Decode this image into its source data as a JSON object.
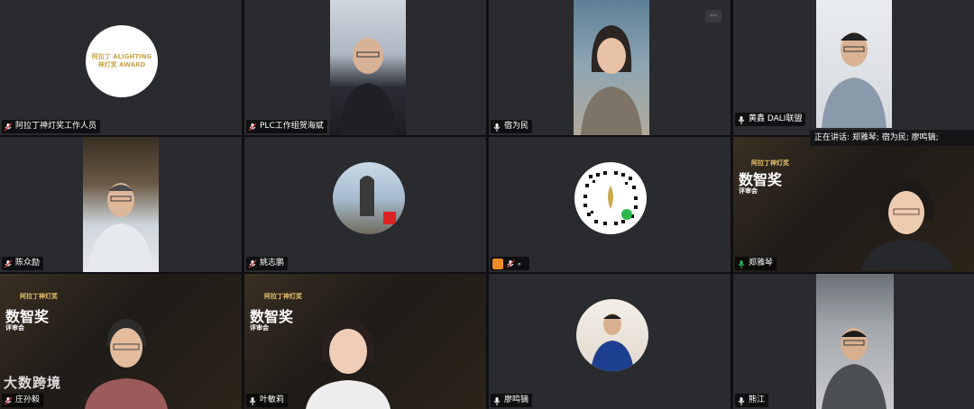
{
  "participants": [
    {
      "name": "阿拉丁神灯奖工作人员"
    },
    {
      "name": "PLC工作组贺海斌"
    },
    {
      "name": "宿为民"
    },
    {
      "name": "黄鑫 DALI联盟"
    },
    {
      "name": "陈众励"
    },
    {
      "name": "姚志鹏"
    },
    {
      "name": "。"
    },
    {
      "name": "郑雅琴"
    },
    {
      "name": "庄孙毅"
    },
    {
      "name": "叶敏莉"
    },
    {
      "name": "廖鸣镝"
    },
    {
      "name": "熊江"
    }
  ],
  "logo": {
    "line1": "阿拉丁 ALIGHTING",
    "line2": "神灯奖 AWARD"
  },
  "speaking": {
    "text": "正在讲话: 郑雅琴; 宿为民; 廖鸣镝;"
  },
  "banner": {
    "brand": "阿拉丁神灯奖",
    "title": "数智奖",
    "subtitle": "评审会"
  },
  "watermark": {
    "text": "大数跨境"
  },
  "more_button": {
    "label": "···"
  },
  "colors": {
    "active_border": "#1fc25a",
    "tile_bg": "#2a2b2f",
    "gold": "#c9a74f"
  }
}
